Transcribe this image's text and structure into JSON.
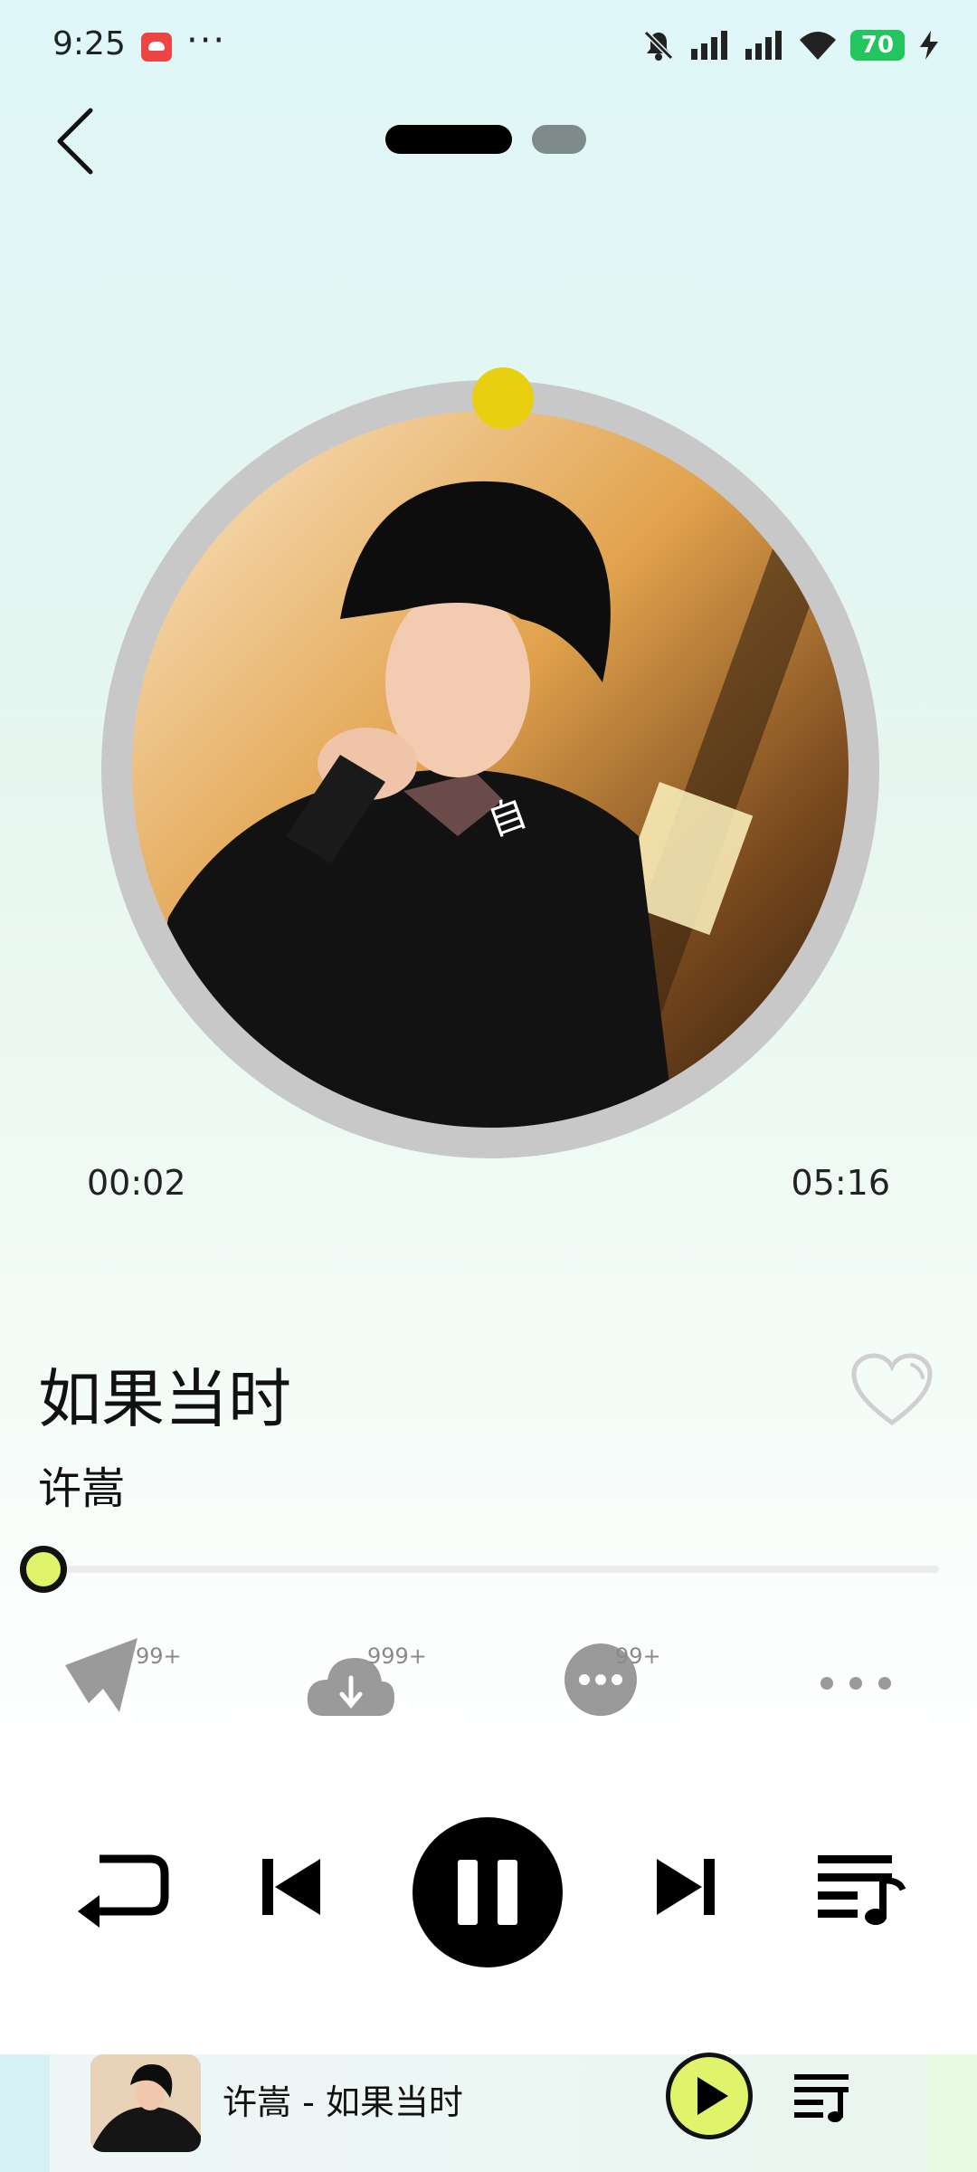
{
  "status_bar": {
    "time": "9:25",
    "dots": "···",
    "battery": "70"
  },
  "player": {
    "elapsed": "00:02",
    "duration": "05:16",
    "title": "如果当时",
    "artist": "许嵩",
    "progress_fraction": 0.006
  },
  "actions": {
    "share_badge": "99+",
    "download_badge": "999+",
    "comment_badge": "99+"
  },
  "mini_player": {
    "text": "许嵩 - 如果当时"
  },
  "colors": {
    "accent": "#dff36b",
    "knob": "#e8d010",
    "ring": "#c8c8c8"
  },
  "icons": [
    "back-icon",
    "heart-icon",
    "share-icon",
    "download-icon",
    "comment-icon",
    "more-icon",
    "repeat-icon",
    "previous-icon",
    "pause-icon",
    "next-icon",
    "playlist-icon",
    "play-icon"
  ]
}
